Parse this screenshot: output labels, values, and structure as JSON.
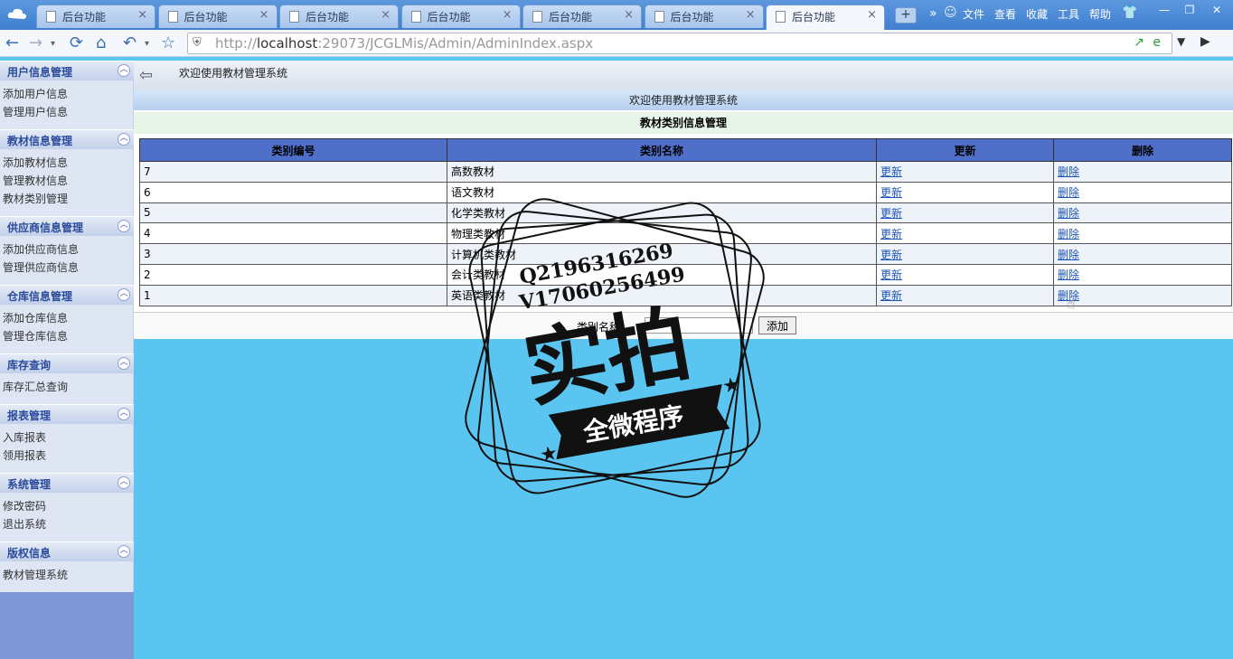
{
  "browser": {
    "tabs": [
      {
        "title": "后台功能",
        "close": "×"
      },
      {
        "title": "后台功能",
        "close": "×"
      },
      {
        "title": "后台功能",
        "close": "×"
      },
      {
        "title": "后台功能",
        "close": "×"
      },
      {
        "title": "后台功能",
        "close": "×"
      },
      {
        "title": "后台功能",
        "close": "×"
      },
      {
        "title": "后台功能",
        "close": "×"
      }
    ],
    "menus": [
      "文件",
      "查看",
      "收藏",
      "工具",
      "帮助"
    ],
    "url_scheme": "http://",
    "url_host": "localhost",
    "url_rest": ":29073/JCGLMis/Admin/AdminIndex.aspx",
    "icons": {
      "back": "back-arrow-icon",
      "forward": "forward-arrow-icon",
      "refresh": "refresh-icon",
      "home": "home-icon",
      "undo": "undo-icon",
      "favorite": "star-icon",
      "shield": "shield-icon",
      "share": "share-icon",
      "ie": "ie-icon"
    }
  },
  "sidebar": {
    "sections": [
      {
        "title": "用户信息管理",
        "items": [
          "添加用户信息",
          "管理用户信息"
        ]
      },
      {
        "title": "教材信息管理",
        "items": [
          "添加教材信息",
          "管理教材信息",
          "教材类别管理"
        ]
      },
      {
        "title": "供应商信息管理",
        "items": [
          "添加供应商信息",
          "管理供应商信息"
        ]
      },
      {
        "title": "仓库信息管理",
        "items": [
          "添加仓库信息",
          "管理仓库信息"
        ]
      },
      {
        "title": "库存查询",
        "items": [
          "库存汇总查询"
        ]
      },
      {
        "title": "报表管理",
        "items": [
          "入库报表",
          "领用报表"
        ]
      },
      {
        "title": "系统管理",
        "items": [
          "修改密码",
          "退出系统"
        ]
      },
      {
        "title": "版权信息",
        "items": [
          "教材管理系统"
        ]
      }
    ]
  },
  "main": {
    "top_welcome": "欢迎使用教材管理系统",
    "title": "欢迎使用教材管理系统",
    "subtitle": "教材类别信息管理",
    "columns": [
      "类别编号",
      "类别名称",
      "更新",
      "删除"
    ],
    "rows": [
      {
        "id": "7",
        "name": "高数教材",
        "update": "更新",
        "delete": "删除"
      },
      {
        "id": "6",
        "name": "语文教材",
        "update": "更新",
        "delete": "删除"
      },
      {
        "id": "5",
        "name": "化学类教材",
        "update": "更新",
        "delete": "删除"
      },
      {
        "id": "4",
        "name": "物理类教材",
        "update": "更新",
        "delete": "删除"
      },
      {
        "id": "3",
        "name": "计算机类教材",
        "update": "更新",
        "delete": "删除"
      },
      {
        "id": "2",
        "name": "会计类教材",
        "update": "更新",
        "delete": "删除"
      },
      {
        "id": "1",
        "name": "英语类教材",
        "update": "更新",
        "delete": "删除"
      }
    ],
    "add_label": "类别名称",
    "add_value": "",
    "add_button": "添加"
  },
  "watermark": {
    "line1": "Q2196316269",
    "line2": "V17060256499",
    "big": "实拍",
    "banner": "全微程序"
  }
}
